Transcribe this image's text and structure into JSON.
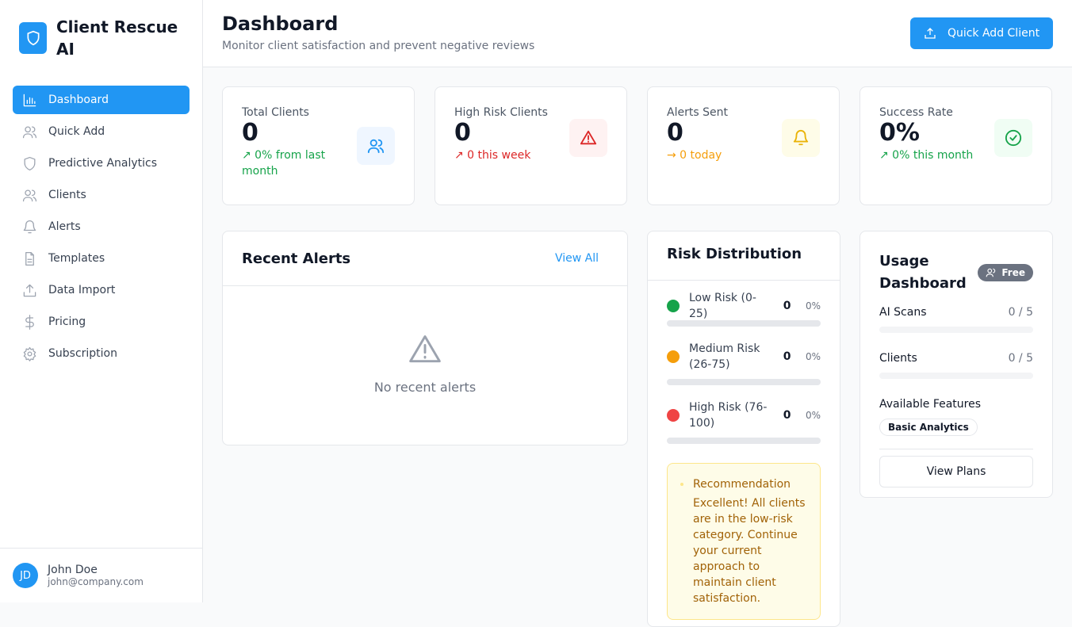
{
  "app": {
    "title": "Client Rescue AI"
  },
  "nav": [
    {
      "label": "Dashboard",
      "icon": "bar-chart-icon"
    },
    {
      "label": "Quick Add",
      "icon": "users-icon"
    },
    {
      "label": "Predictive Analytics",
      "icon": "shield-icon"
    },
    {
      "label": "Clients",
      "icon": "users-icon"
    },
    {
      "label": "Alerts",
      "icon": "bell-icon"
    },
    {
      "label": "Templates",
      "icon": "file-text-icon"
    },
    {
      "label": "Data Import",
      "icon": "upload-icon"
    },
    {
      "label": "Pricing",
      "icon": "dollar-icon"
    },
    {
      "label": "Subscription",
      "icon": "gear-icon"
    }
  ],
  "user": {
    "initials": "JD",
    "name": "John Doe",
    "email": "john@company.com"
  },
  "header": {
    "title": "Dashboard",
    "subtitle": "Monitor client satisfaction and prevent negative reviews",
    "button": "Quick Add Client"
  },
  "stats": [
    {
      "label": "Total Clients",
      "value": "0",
      "change": "↗ 0% from last month",
      "color": "#16a34a"
    },
    {
      "label": "High Risk Clients",
      "value": "0",
      "change": "↗ 0 this week",
      "color": "#dc2626"
    },
    {
      "label": "Alerts Sent",
      "value": "0",
      "change": "→ 0 today",
      "color": "#f59e0b"
    },
    {
      "label": "Success Rate",
      "value": "0%",
      "change": "↗ 0% this month",
      "color": "#16a34a"
    }
  ],
  "alerts": {
    "title": "Recent Alerts",
    "view_all": "View All",
    "empty": "No recent alerts"
  },
  "risk": {
    "title": "Risk Distribution",
    "rows": [
      {
        "label": "Low Risk (0-25)",
        "count": "0",
        "percent": "0%",
        "fraction": 0,
        "color": "#16a34a"
      },
      {
        "label": "Medium Risk (26-75)",
        "count": "0",
        "percent": "0%",
        "fraction": 0,
        "color": "#f59e0b"
      },
      {
        "label": "High Risk (76-100)",
        "count": "0",
        "percent": "0%",
        "fraction": 0,
        "color": "#ef4444"
      }
    ],
    "rec_title": "Recommendation",
    "rec_text": "Excellent! All clients are in the low-risk category. Continue your current approach to maintain client satisfaction."
  },
  "usage": {
    "title": "Usage Dashboard",
    "plan": "Free",
    "scans_label": "AI Scans",
    "scans_value": "0 / 5",
    "scans_fraction": 0,
    "clients_label": "Clients",
    "clients_value": "0 / 5",
    "clients_fraction": 0,
    "features_label": "Available Features",
    "feature": "Basic Analytics",
    "button": "View Plans"
  }
}
